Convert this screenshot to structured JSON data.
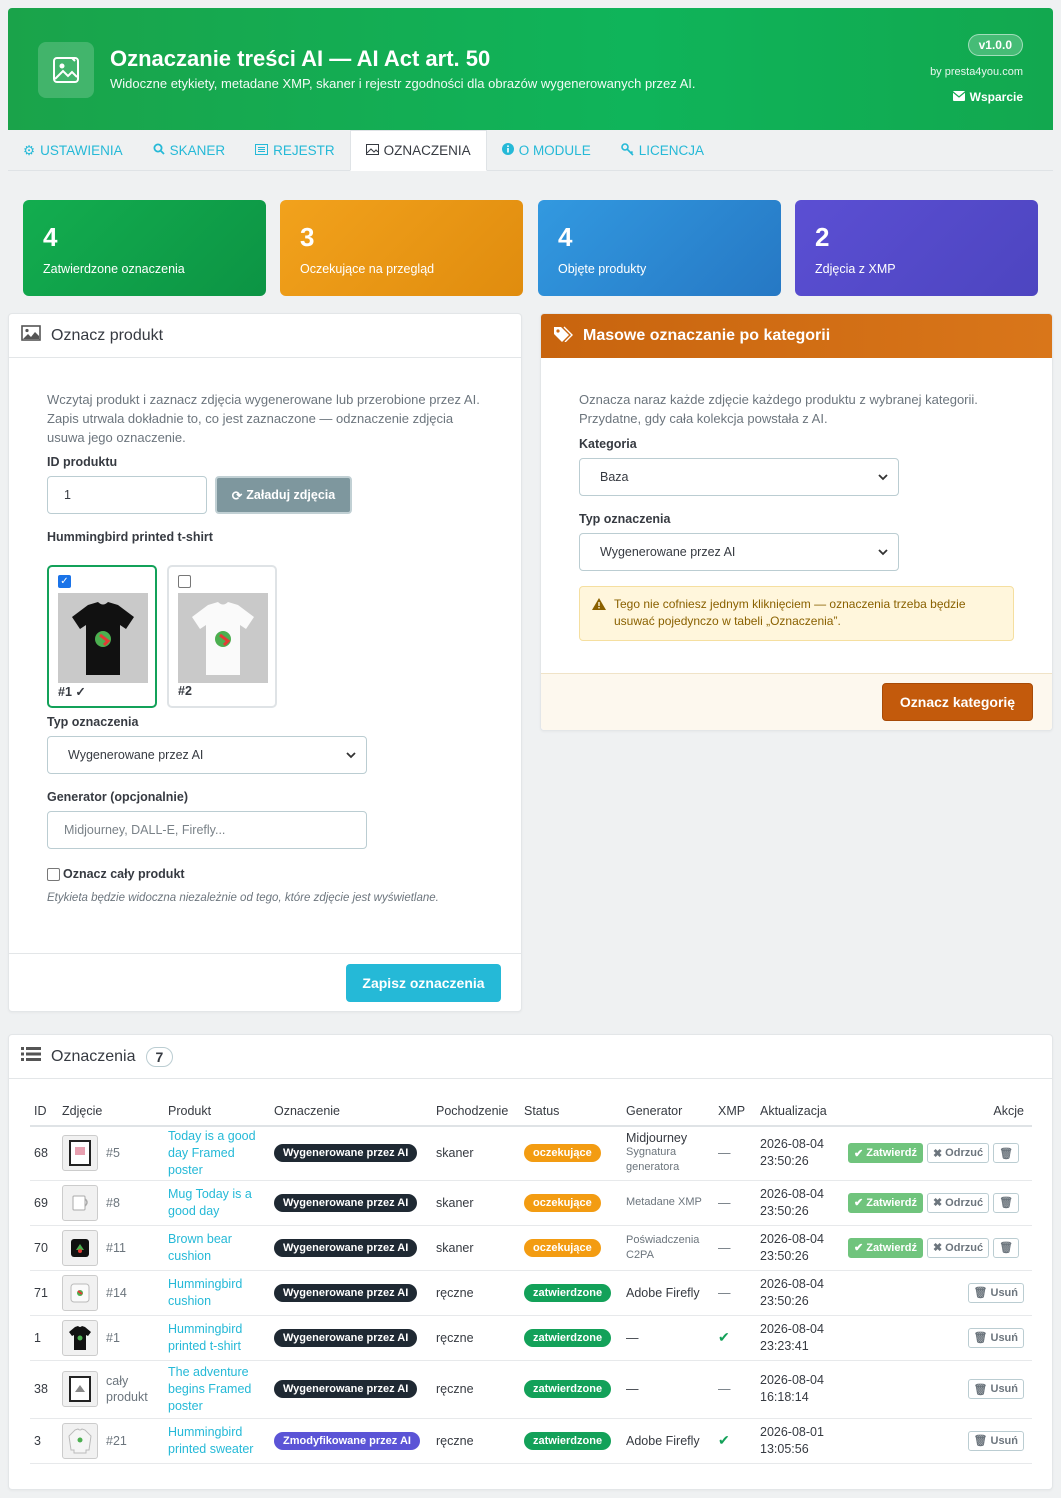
{
  "header": {
    "title": "Oznaczanie treści AI — AI Act art. 50",
    "subtitle": "Widoczne etykiety, metadane XMP, skaner i rejestr zgodności dla obrazów wygenerowanych przez AI.",
    "version": "v1.0.0",
    "by": "by presta4you.com",
    "support": "Wsparcie"
  },
  "tabs": [
    "USTAWIENIA",
    "SKANER",
    "REJESTR",
    "OZNACZENIA",
    "O MODULE",
    "LICENCJA"
  ],
  "stats": [
    {
      "value": "4",
      "label": "Zatwierdzone oznaczenia",
      "color": "#14a34c"
    },
    {
      "value": "3",
      "label": "Oczekujące na przegląd",
      "color": "#f0a01b"
    },
    {
      "value": "4",
      "label": "Objęte produkty",
      "color": "#2d8fd8"
    },
    {
      "value": "2",
      "label": "Zdjęcia z XMP",
      "color": "#5a4fcf"
    }
  ],
  "mark_product": {
    "title": "Oznacz produkt",
    "intro": "Wczytaj produkt i zaznacz zdjęcia wygenerowane lub przerobione przez AI. Zapis utrwala dokładnie to, co jest zaznaczone — odznaczenie zdjęcia usuwa jego oznaczenie.",
    "id_label": "ID produktu",
    "id_value": "1",
    "load_button": "Załaduj zdjęcia",
    "product_name": "Hummingbird printed t-shirt",
    "images": [
      {
        "label": "#1 ✓",
        "checked": true
      },
      {
        "label": "#2",
        "checked": false
      }
    ],
    "type_label": "Typ oznaczenia",
    "type_value": "Wygenerowane przez AI",
    "generator_label": "Generator (opcjonalnie)",
    "generator_placeholder": "Midjourney, DALL-E, Firefly...",
    "whole_product_label": "Oznacz cały produkt",
    "whole_product_hint": "Etykieta będzie widoczna niezależnie od tego, które zdjęcie jest wyświetlane.",
    "save_button": "Zapisz oznaczenia"
  },
  "bulk": {
    "title": "Masowe oznaczanie po kategorii",
    "intro": "Oznacza naraz każde zdjęcie każdego produktu z wybranej kategorii. Przydatne, gdy cała kolekcja powstała z AI.",
    "category_label": "Kategoria",
    "category_value": "Baza",
    "type_label": "Typ oznaczenia",
    "type_value": "Wygenerowane przez AI",
    "warning": "Tego nie cofniesz jednym kliknięciem — oznaczenia trzeba będzie usuwać pojedynczo w tabeli „Oznaczenia”.",
    "button": "Oznacz kategorię"
  },
  "list": {
    "title": "Oznaczenia",
    "count": "7",
    "columns": [
      "ID",
      "Zdjęcie",
      "Produkt",
      "Oznaczenie",
      "Pochodzenie",
      "Status",
      "Generator",
      "XMP",
      "Aktualizacja",
      "Akcje"
    ],
    "rows": [
      {
        "id": "68",
        "img": "#5",
        "product": "Today is a good day Framed poster",
        "mark": "Wygenerowane przez AI",
        "origin": "skaner",
        "status": "oczekujące",
        "generator": "Midjourney",
        "generator_note": "Sygnatura generatora",
        "xmp": "—",
        "date": "2026-08-04",
        "time": "23:50:26"
      },
      {
        "id": "69",
        "img": "#8",
        "product": "Mug Today is a good day",
        "mark": "Wygenerowane przez AI",
        "origin": "skaner",
        "status": "oczekujące",
        "generator": "",
        "generator_note": "Metadane XMP",
        "xmp": "—",
        "date": "2026-08-04",
        "time": "23:50:26"
      },
      {
        "id": "70",
        "img": "#11",
        "product": "Brown bear cushion",
        "mark": "Wygenerowane przez AI",
        "origin": "skaner",
        "status": "oczekujące",
        "generator": "",
        "generator_note": "Poświadczenia C2PA",
        "xmp": "—",
        "date": "2026-08-04",
        "time": "23:50:26"
      },
      {
        "id": "71",
        "img": "#14",
        "product": "Hummingbird cushion",
        "mark": "Wygenerowane przez AI",
        "origin": "ręczne",
        "status": "zatwierdzone",
        "generator": "Adobe Firefly",
        "generator_note": "",
        "xmp": "—",
        "date": "2026-08-04",
        "time": "23:50:26"
      },
      {
        "id": "1",
        "img": "#1",
        "product": "Hummingbird printed t-shirt",
        "mark": "Wygenerowane przez AI",
        "origin": "ręczne",
        "status": "zatwierdzone",
        "generator": "—",
        "generator_note": "",
        "xmp": "✔",
        "date": "2026-08-04",
        "time": "23:23:41"
      },
      {
        "id": "38",
        "img": "cały produkt",
        "product": "The adventure begins Framed poster",
        "mark": "Wygenerowane przez AI",
        "origin": "ręczne",
        "status": "zatwierdzone",
        "generator": "—",
        "generator_note": "",
        "xmp": "—",
        "date": "2026-08-04",
        "time": "16:18:14"
      },
      {
        "id": "3",
        "img": "#21",
        "product": "Hummingbird printed sweater",
        "mark": "Zmodyfikowane przez AI",
        "origin": "ręczne",
        "status": "zatwierdzone",
        "generator": "Adobe Firefly",
        "generator_note": "",
        "xmp": "✔",
        "date": "2026-08-01",
        "time": "13:05:56"
      }
    ],
    "actions": {
      "approve": "Zatwierdź",
      "reject": "Odrzuć",
      "delete": "Usuń"
    }
  }
}
